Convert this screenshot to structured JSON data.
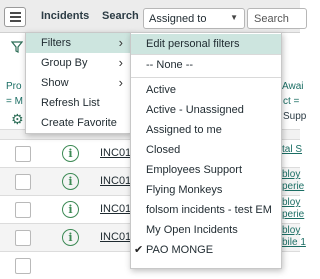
{
  "header": {
    "title": "Incidents",
    "search_label": "Search",
    "selected_field": "Assigned to",
    "search_placeholder": "Search"
  },
  "behind_text": {
    "pro1": "Pro",
    "m1": "= M",
    "awai": "Awai",
    "ct": "ct =",
    "supp": "Supp"
  },
  "rows": [
    {
      "number": "INC01",
      "tail": "tal S"
    },
    {
      "number": "INC01",
      "tail": "bloy",
      "tail2": "perie"
    },
    {
      "number": "INC01",
      "tail": "bloy",
      "tail2": "perie"
    },
    {
      "number": "INC01",
      "tail": "bloy",
      "tail2": "bile 1"
    }
  ],
  "context_menu": {
    "items": [
      {
        "label": "Filters",
        "has_submenu": true
      },
      {
        "label": "Group By",
        "has_submenu": true
      },
      {
        "label": "Show",
        "has_submenu": true
      },
      {
        "label": "Refresh List",
        "has_submenu": false
      },
      {
        "label": "Create Favorite",
        "has_submenu": false
      }
    ]
  },
  "filters_submenu": {
    "edit": "Edit personal filters",
    "none": "-- None --",
    "options": [
      "Active",
      "Active - Unassigned",
      "Assigned to me",
      "Closed",
      "Employees Support",
      "Flying Monkeys",
      "folsom incidents - test EM",
      "My Open Incidents",
      "PAO MONGE"
    ],
    "checked": "PAO MONGE"
  },
  "icons": {
    "menu": "hamburger-icon",
    "filter": "funnel-icon",
    "settings": "gear-icon",
    "info": "info-circle-icon",
    "submenu": "chevron-right-icon",
    "dropdown": "caret-down-icon",
    "selected": "checkmark-icon"
  },
  "colors": {
    "accent": "#1b6e64",
    "highlight": "#cde5df",
    "info_green": "#3d8a55"
  }
}
